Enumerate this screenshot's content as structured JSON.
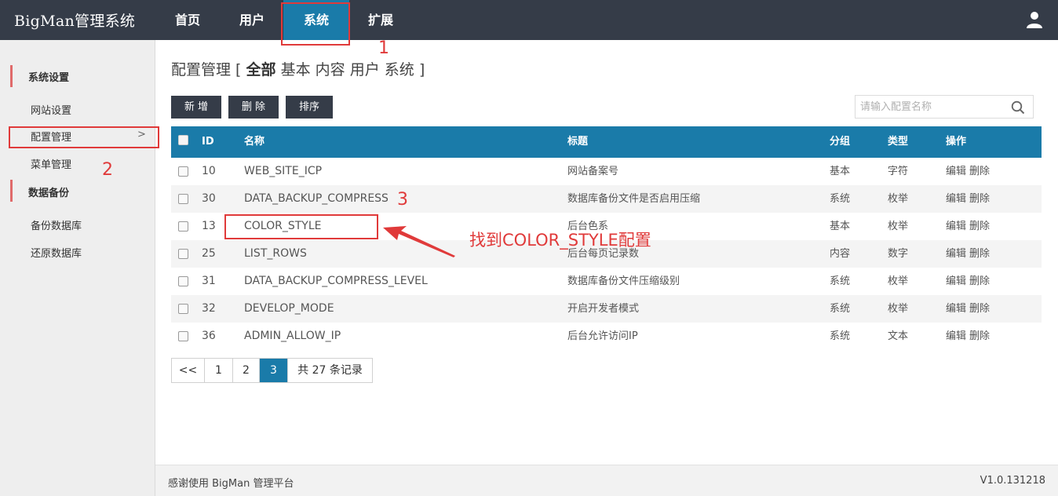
{
  "app": {
    "logo": "BigMan管理系统"
  },
  "nav": {
    "items": [
      {
        "label": "首页"
      },
      {
        "label": "用户"
      },
      {
        "label": "系统"
      },
      {
        "label": "扩展"
      }
    ]
  },
  "sidebar": {
    "groups": [
      {
        "title": "系统设置",
        "items": [
          "网站设置",
          "配置管理",
          "菜单管理"
        ]
      },
      {
        "title": "数据备份",
        "items": [
          "备份数据库",
          "还原数据库"
        ]
      }
    ],
    "arrow": ">"
  },
  "page": {
    "title_prefix": "配置管理 [",
    "filter_current": "全部",
    "filters": [
      "基本",
      "内容",
      "用户",
      "系统"
    ],
    "title_suffix": "]"
  },
  "toolbar": {
    "add_label": "新 增",
    "delete_label": "删 除",
    "sort_label": "排序"
  },
  "search": {
    "placeholder": "请输入配置名称"
  },
  "table": {
    "headers": {
      "id": "ID",
      "name": "名称",
      "title": "标题",
      "group": "分组",
      "type": "类型",
      "ops": "操作"
    },
    "rows": [
      {
        "id": "10",
        "name": "WEB_SITE_ICP",
        "title": "网站备案号",
        "group": "基本",
        "type": "字符"
      },
      {
        "id": "30",
        "name": "DATA_BACKUP_COMPRESS",
        "title": "数据库备份文件是否启用压缩",
        "group": "系统",
        "type": "枚举"
      },
      {
        "id": "13",
        "name": "COLOR_STYLE",
        "title": "后台色系",
        "group": "基本",
        "type": "枚举"
      },
      {
        "id": "25",
        "name": "LIST_ROWS",
        "title": "后台每页记录数",
        "group": "内容",
        "type": "数字"
      },
      {
        "id": "31",
        "name": "DATA_BACKUP_COMPRESS_LEVEL",
        "title": "数据库备份文件压缩级别",
        "group": "系统",
        "type": "枚举"
      },
      {
        "id": "32",
        "name": "DEVELOP_MODE",
        "title": "开启开发者模式",
        "group": "系统",
        "type": "枚举"
      },
      {
        "id": "36",
        "name": "ADMIN_ALLOW_IP",
        "title": "后台允许访问IP",
        "group": "系统",
        "type": "文本"
      }
    ],
    "edit_label": "编辑",
    "delete_label": "删除"
  },
  "pager": {
    "prev": "<<",
    "pages": [
      "1",
      "2",
      "3"
    ],
    "current": "3",
    "total_text": "共 27 条记录"
  },
  "annotations": {
    "num1": "1",
    "num2": "2",
    "num3": "3",
    "note": "找到COLOR_STYLE配置",
    "color": "#e03a3a"
  },
  "footer": {
    "left": "感谢使用 BigMan 管理平台",
    "version": "V1.0.131218"
  },
  "colors": {
    "topbar": "#353c48",
    "accent": "#1a7ba9",
    "sidebar": "#eeeeee",
    "sidebar_mark": "#e06a6a"
  }
}
